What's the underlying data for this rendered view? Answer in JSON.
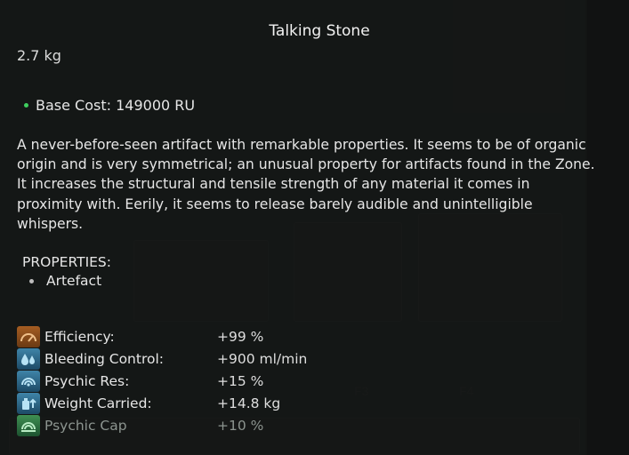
{
  "tooltip": {
    "title": "Talking Stone",
    "weight": "2.7 kg",
    "base_cost": "Base Cost: 149000 RU",
    "description": "A never-before-seen artifact with remarkable properties. It seems to be of organic origin and is very symmetrical; an unusual property for artifacts found in the Zone. It increases the structural and tensile strength of any material it comes in proximity with. Eerily, it seems to release barely audible and unintelligible whispers.",
    "properties_heading": "PROPERTIES:",
    "properties": [
      "Artefact"
    ],
    "stats": [
      {
        "label": "Efficiency:",
        "value": "+99 %",
        "icon": "efficiency-icon",
        "color": "#a55d22"
      },
      {
        "label": "Bleeding Control:",
        "value": "+900 ml/min",
        "icon": "bleeding-icon",
        "color": "#3f84a8"
      },
      {
        "label": "Psychic Res:",
        "value": "+15 %",
        "icon": "psychic-res-icon",
        "color": "#3f84a8"
      },
      {
        "label": "Weight Carried:",
        "value": "+14.8 kg",
        "icon": "weight-icon",
        "color": "#3f84a8"
      },
      {
        "label": "Psychic Cap",
        "value": "+10 %",
        "icon": "psychic-cap-icon",
        "color": "#3f8f52"
      }
    ]
  },
  "colors": {
    "bullet_green": "#3fcf5e",
    "dim_text": "#8c948f"
  }
}
